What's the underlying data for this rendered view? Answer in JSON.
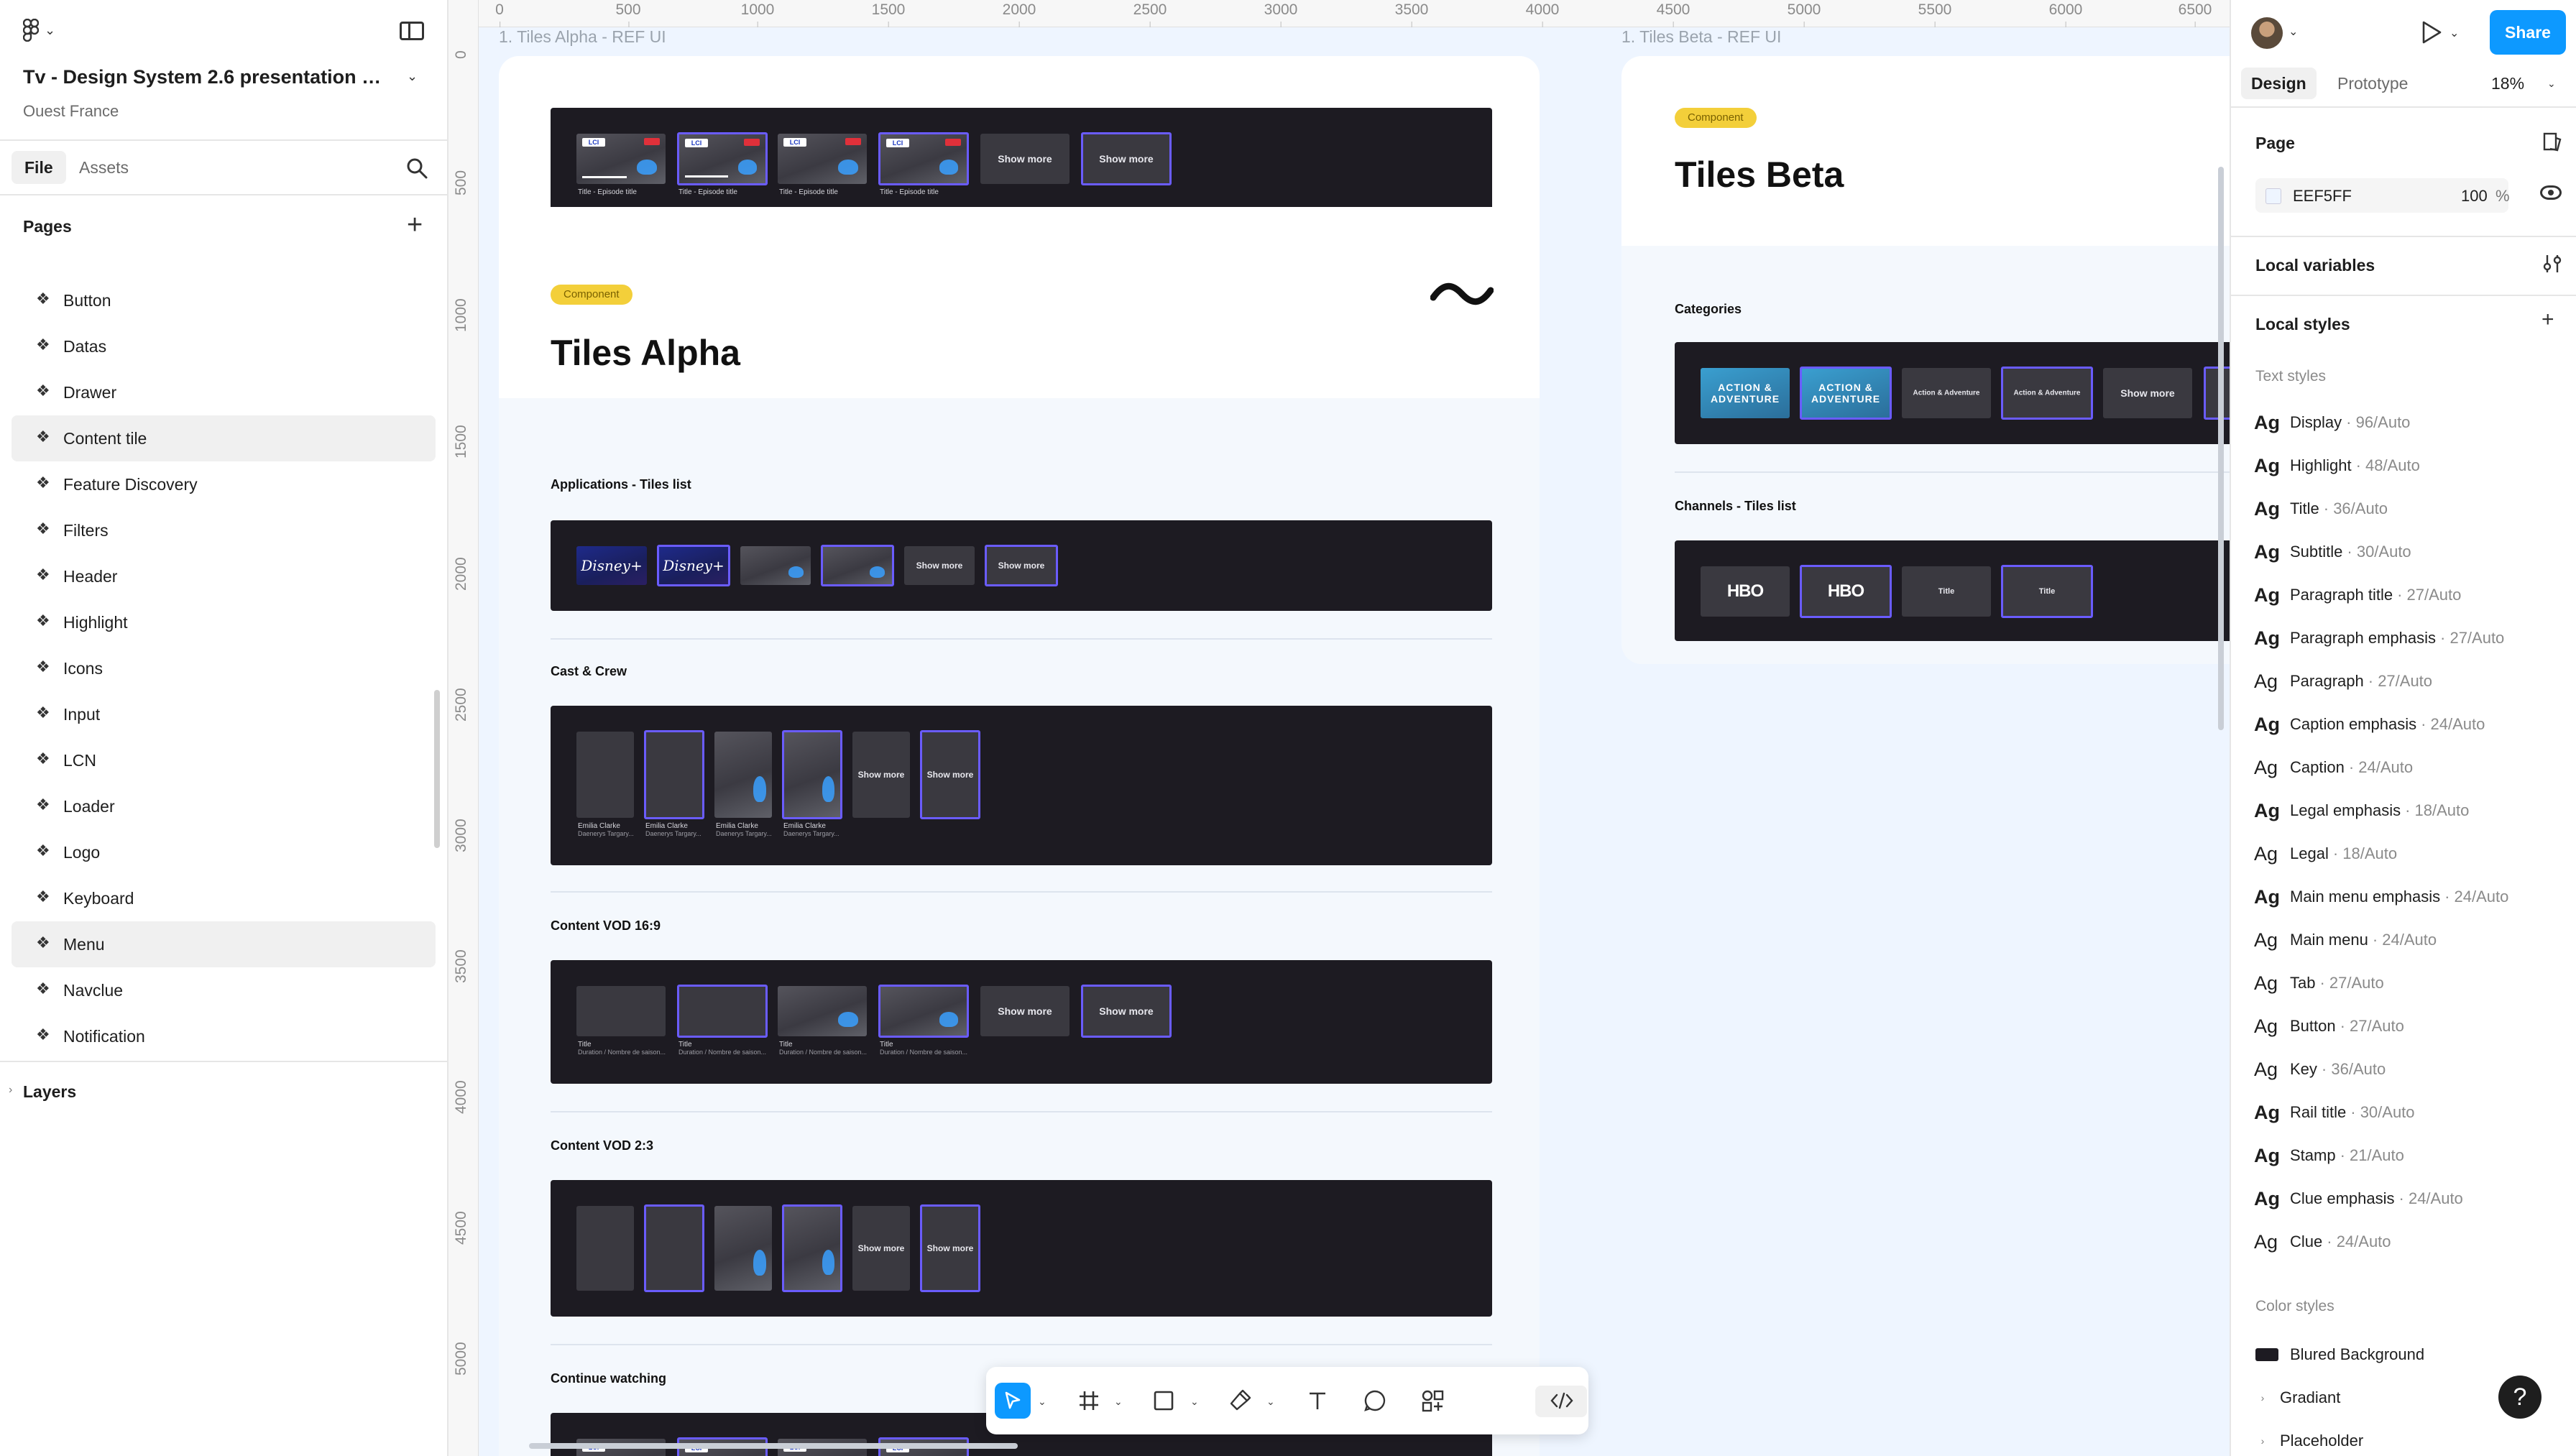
{
  "app": {
    "file_title": "Tv - Design System 2.6 presentation s...",
    "team": "Ouest France",
    "tabs": {
      "file": "File",
      "assets": "Assets"
    },
    "pages_label": "Pages",
    "layers_label": "Layers",
    "pages": [
      "Button",
      "Datas",
      "Drawer",
      "Content tile",
      "Feature Discovery",
      "Filters",
      "Header",
      "Highlight",
      "Icons",
      "Input",
      "LCN",
      "Loader",
      "Logo",
      "Keyboard",
      "Menu",
      "Navclue",
      "Notification"
    ]
  },
  "rulers": {
    "x": [
      "0",
      "500",
      "1000",
      "1500",
      "2000",
      "2500",
      "3000",
      "3500",
      "4000",
      "4500",
      "5000",
      "5500",
      "6000",
      "6500"
    ],
    "y": [
      "0",
      "500",
      "1000",
      "1500",
      "2000",
      "2500",
      "3000",
      "3500",
      "4000",
      "4500",
      "5000"
    ]
  },
  "canvas": {
    "alpha_label": "1. Tiles Alpha - REF UI",
    "beta_label": "1. Tiles Beta - REF UI",
    "badge": "Component",
    "alpha_title": "Tiles Alpha",
    "beta_title": "Tiles Beta",
    "sections": {
      "apps": "Applications - Tiles list",
      "cast": "Cast & Crew",
      "vod169": "Content VOD 16:9",
      "vod23": "Content VOD 2:3",
      "continue": "Continue watching",
      "categories": "Categories",
      "channels": "Channels - Tiles list"
    },
    "tile_text": {
      "show_more": "Show more",
      "show_more_2line": "Show more",
      "disney": "Disney+",
      "hbo": "HBO",
      "title": "Title",
      "action": "ACTION & ADVENTURE",
      "action_plain": "Action & Adventure",
      "episode_title": "Title - Episode title",
      "episode_time": "0:00PM - 11:00AM",
      "cast_name": "Emilia Clarke",
      "cast_role": "Daenerys Targary...",
      "vod_title": "Title",
      "vod_sub": "Duration / Nombre de saison..."
    }
  },
  "toolbar": {
    "tools": [
      "move-tool",
      "frame-tool",
      "shape-tool",
      "pen-tool",
      "text-tool",
      "comment-tool",
      "actions-tool",
      "dev-mode-toggle"
    ]
  },
  "right": {
    "share": "Share",
    "tab_design": "Design",
    "tab_prototype": "Prototype",
    "zoom": "18%",
    "page_heading": "Page",
    "page_color": "EEF5FF",
    "page_opacity": "100",
    "page_opacity_unit": "%",
    "local_variables": "Local variables",
    "local_styles": "Local styles",
    "text_styles_label": "Text styles",
    "text_style_glyph": "Ag",
    "text_styles": [
      {
        "name": "Display",
        "meta": "· 96/Auto"
      },
      {
        "name": "Highlight",
        "meta": "· 48/Auto"
      },
      {
        "name": "Title",
        "meta": "· 36/Auto"
      },
      {
        "name": "Subtitle",
        "meta": "· 30/Auto"
      },
      {
        "name": "Paragraph title",
        "meta": "· 27/Auto"
      },
      {
        "name": "Paragraph emphasis",
        "meta": "· 27/Auto"
      },
      {
        "name": "Paragraph",
        "meta": "· 27/Auto"
      },
      {
        "name": "Caption emphasis",
        "meta": "· 24/Auto"
      },
      {
        "name": "Caption",
        "meta": "· 24/Auto"
      },
      {
        "name": "Legal emphasis",
        "meta": "· 18/Auto"
      },
      {
        "name": "Legal",
        "meta": "· 18/Auto"
      },
      {
        "name": "Main menu emphasis",
        "meta": "· 24/Auto"
      },
      {
        "name": "Main menu",
        "meta": "· 24/Auto"
      },
      {
        "name": "Tab",
        "meta": "· 27/Auto"
      },
      {
        "name": "Button",
        "meta": "· 27/Auto"
      },
      {
        "name": "Key",
        "meta": "· 36/Auto"
      },
      {
        "name": "Rail title",
        "meta": "· 30/Auto"
      },
      {
        "name": "Stamp",
        "meta": "· 21/Auto"
      },
      {
        "name": "Clue emphasis",
        "meta": "· 24/Auto"
      },
      {
        "name": "Clue",
        "meta": "· 24/Auto"
      }
    ],
    "color_styles_label": "Color styles",
    "color_styles": [
      "Blured Background",
      "Gradiant",
      "Placeholder"
    ],
    "help": "?"
  },
  "colors": {
    "accent": "#0d99ff",
    "canvas_bg": "#eef5ff",
    "tile_bg": "#1d1b22",
    "selection": "#6a5cff",
    "badge": "#f3cf3a"
  }
}
